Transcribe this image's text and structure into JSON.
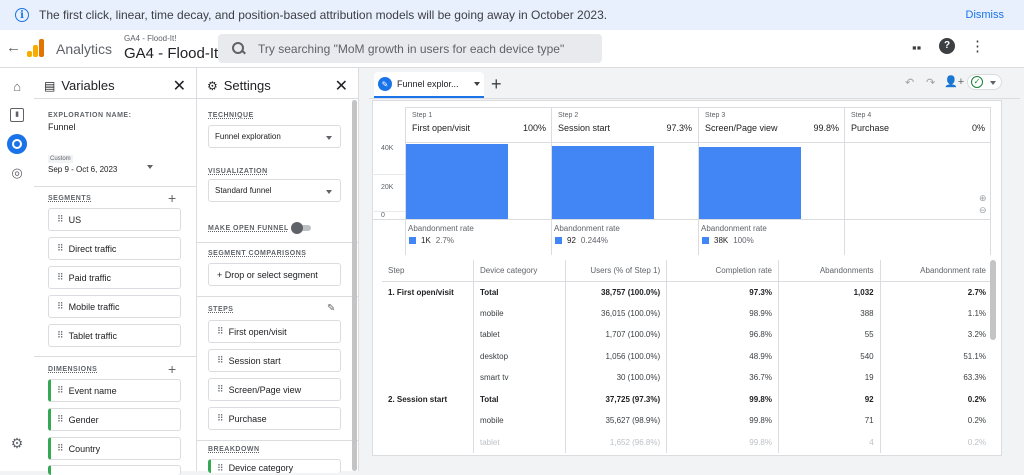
{
  "banner": {
    "message": "The first click, linear, time decay, and position-based attribution models will be going away in October 2023.",
    "dismiss": "Dismiss"
  },
  "header": {
    "app_name": "Analytics",
    "account_sub": "GA4 - Flood-It!",
    "account_main": "GA4 - Flood-It!",
    "search_placeholder": "Try searching \"MoM growth in users for each device type\""
  },
  "variables": {
    "title": "Variables",
    "exploration_name_label": "EXPLORATION NAME:",
    "exploration_name": "Funnel",
    "date_tag": "Custom",
    "date_range": "Sep 9 - Oct 6, 2023",
    "segments_label": "SEGMENTS",
    "segments": [
      "US",
      "Direct traffic",
      "Paid traffic",
      "Mobile traffic",
      "Tablet traffic"
    ],
    "dimensions_label": "DIMENSIONS",
    "dimensions": [
      "Event name",
      "Gender",
      "Country"
    ]
  },
  "settings": {
    "title": "Settings",
    "technique_label": "TECHNIQUE",
    "technique": "Funnel exploration",
    "visualization_label": "VISUALIZATION",
    "visualization": "Standard funnel",
    "open_funnel_label": "MAKE OPEN FUNNEL",
    "segment_comparisons_label": "SEGMENT COMPARISONS",
    "segment_drop": "+ Drop or select segment",
    "steps_label": "STEPS",
    "steps": [
      "First open/visit",
      "Session start",
      "Screen/Page view",
      "Purchase"
    ],
    "breakdown_label": "BREAKDOWN",
    "breakdown": "Device category"
  },
  "tab": {
    "label": "Funnel explor..."
  },
  "chart_data": {
    "type": "bar",
    "categories": [
      "First open/visit",
      "Session start",
      "Screen/Page view",
      "Purchase"
    ],
    "step_labels": [
      "Step 1",
      "Step 2",
      "Step 3",
      "Step 4"
    ],
    "percentages": [
      "100%",
      "97.3%",
      "99.8%",
      "0%"
    ],
    "values": [
      38757,
      37725,
      37632,
      0
    ],
    "y_ticks": [
      "40K",
      "20K",
      "0"
    ],
    "ylim": [
      0,
      40000
    ],
    "abandonment_label": "Abandonment rate",
    "abandonment": [
      {
        "count": "1K",
        "rate": "2.7%"
      },
      {
        "count": "92",
        "rate": "0.244%"
      },
      {
        "count": "38K",
        "rate": "100%"
      }
    ],
    "bar_color": "#4285f4"
  },
  "table": {
    "headers": [
      "Step",
      "Device category",
      "Users (% of Step 1)",
      "Completion rate",
      "Abandonments",
      "Abandonment rate"
    ],
    "rows": [
      [
        "1. First open/visit",
        "Total",
        "38,757 (100.0%)",
        "97.3%",
        "1,032",
        "2.7%"
      ],
      [
        "",
        "mobile",
        "36,015 (100.0%)",
        "98.9%",
        "388",
        "1.1%"
      ],
      [
        "",
        "tablet",
        "1,707 (100.0%)",
        "96.8%",
        "55",
        "3.2%"
      ],
      [
        "",
        "desktop",
        "1,056 (100.0%)",
        "48.9%",
        "540",
        "51.1%"
      ],
      [
        "",
        "smart tv",
        "30 (100.0%)",
        "36.7%",
        "19",
        "63.3%"
      ],
      [
        "2. Session start",
        "Total",
        "37,725 (97.3%)",
        "99.8%",
        "92",
        "0.2%"
      ],
      [
        "",
        "mobile",
        "35,627 (98.9%)",
        "99.8%",
        "71",
        "0.2%"
      ],
      [
        "",
        "tablet",
        "1,652 (96.8%)",
        "99.8%",
        "4",
        "0.2%"
      ]
    ]
  }
}
